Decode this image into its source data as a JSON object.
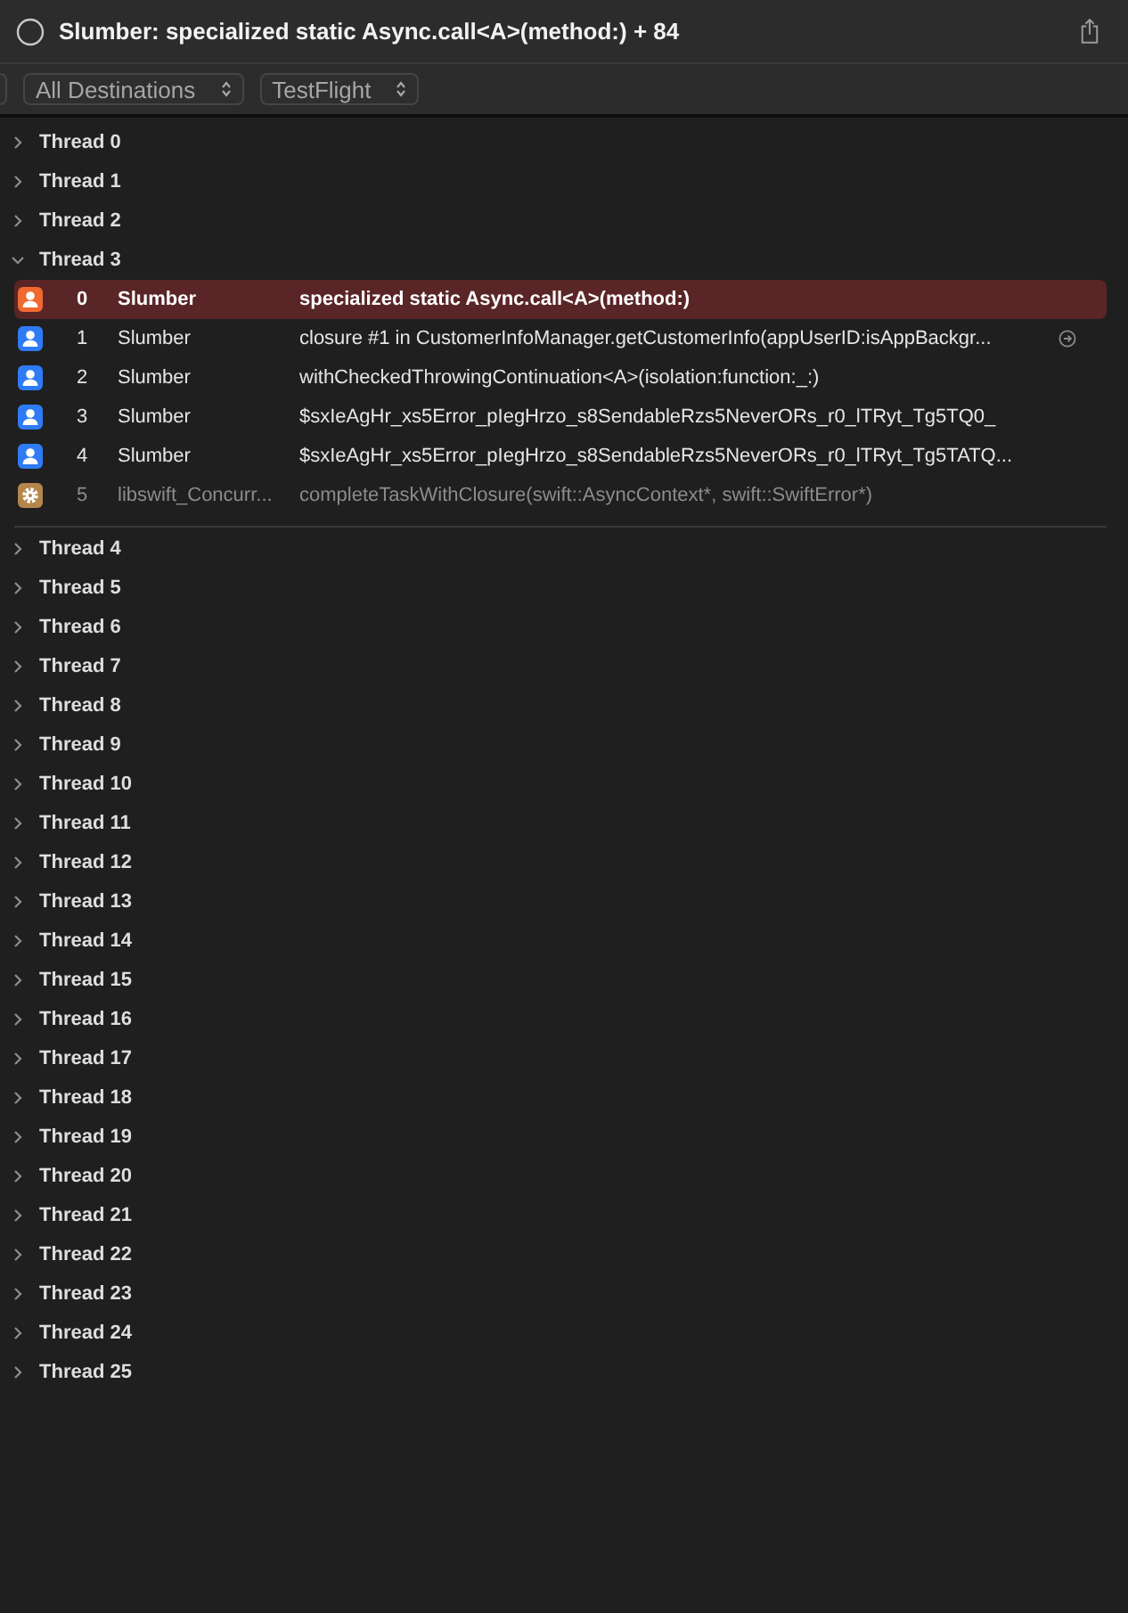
{
  "window": {
    "title": "Slumber: specialized static Async.call<A>(method:) + 84"
  },
  "toolbar": {
    "popups": [
      {
        "label": "All Destinations"
      },
      {
        "label": "TestFlight"
      }
    ]
  },
  "threads": [
    {
      "label": "Thread 0",
      "expanded": false
    },
    {
      "label": "Thread 1",
      "expanded": false
    },
    {
      "label": "Thread 2",
      "expanded": false
    },
    {
      "label": "Thread 3",
      "expanded": true,
      "frames": [
        {
          "kind": "user",
          "index": "0",
          "module": "Slumber",
          "function": "specialized static Async.call<A>(method:)",
          "selected": true,
          "detail_button": false
        },
        {
          "kind": "user",
          "index": "1",
          "module": "Slumber",
          "function": "closure #1 in CustomerInfoManager.getCustomerInfo(appUserID:isAppBackgr...",
          "selected": false,
          "detail_button": true
        },
        {
          "kind": "user",
          "index": "2",
          "module": "Slumber",
          "function": "withCheckedThrowingContinuation<A>(isolation:function:_:)",
          "selected": false,
          "detail_button": false
        },
        {
          "kind": "user",
          "index": "3",
          "module": "Slumber",
          "function": "$sxIeAgHr_xs5Error_pIegHrzo_s8SendableRzs5NeverORs_r0_lTRyt_Tg5TQ0_",
          "selected": false,
          "detail_button": false
        },
        {
          "kind": "user",
          "index": "4",
          "module": "Slumber",
          "function": "$sxIeAgHr_xs5Error_pIegHrzo_s8SendableRzs5NeverORs_r0_lTRyt_Tg5TATQ...",
          "selected": false,
          "detail_button": false
        },
        {
          "kind": "system",
          "index": "5",
          "module": "libswift_Concurr...",
          "function": "completeTaskWithClosure(swift::AsyncContext*, swift::SwiftError*)",
          "selected": false,
          "detail_button": false
        }
      ]
    },
    {
      "label": "Thread 4",
      "expanded": false
    },
    {
      "label": "Thread 5",
      "expanded": false
    },
    {
      "label": "Thread 6",
      "expanded": false
    },
    {
      "label": "Thread 7",
      "expanded": false
    },
    {
      "label": "Thread 8",
      "expanded": false
    },
    {
      "label": "Thread 9",
      "expanded": false
    },
    {
      "label": "Thread 10",
      "expanded": false
    },
    {
      "label": "Thread 11",
      "expanded": false
    },
    {
      "label": "Thread 12",
      "expanded": false
    },
    {
      "label": "Thread 13",
      "expanded": false
    },
    {
      "label": "Thread 14",
      "expanded": false
    },
    {
      "label": "Thread 15",
      "expanded": false
    },
    {
      "label": "Thread 16",
      "expanded": false
    },
    {
      "label": "Thread 17",
      "expanded": false
    },
    {
      "label": "Thread 18",
      "expanded": false
    },
    {
      "label": "Thread 19",
      "expanded": false
    },
    {
      "label": "Thread 20",
      "expanded": false
    },
    {
      "label": "Thread 21",
      "expanded": false
    },
    {
      "label": "Thread 22",
      "expanded": false
    },
    {
      "label": "Thread 23",
      "expanded": false
    },
    {
      "label": "Thread 24",
      "expanded": false
    },
    {
      "label": "Thread 25",
      "expanded": false
    }
  ]
}
